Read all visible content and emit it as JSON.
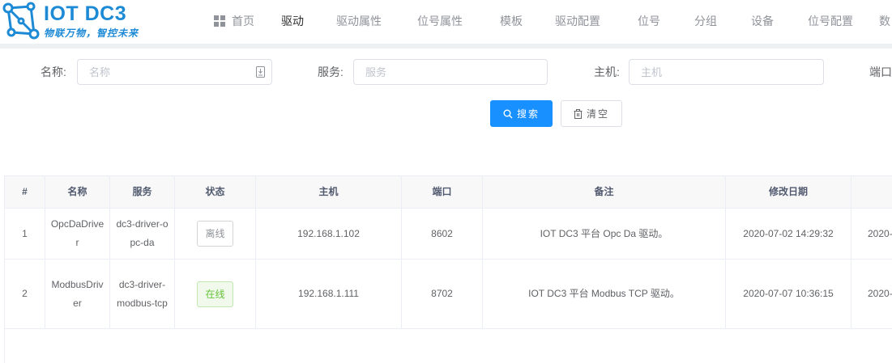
{
  "logo": {
    "title": "IOT DC3",
    "subtitle": "物联万物，智控未来"
  },
  "nav": [
    {
      "label": "首页"
    },
    {
      "label": "驱动"
    },
    {
      "label": "驱动属性"
    },
    {
      "label": "位号属性"
    },
    {
      "label": "模板"
    },
    {
      "label": "驱动配置"
    },
    {
      "label": "位号"
    },
    {
      "label": "分组"
    },
    {
      "label": "设备"
    },
    {
      "label": "位号配置"
    },
    {
      "label": "数"
    }
  ],
  "nav_active": "驱动",
  "search": {
    "name_label": "名称:",
    "name_placeholder": "名称",
    "service_label": "服务:",
    "service_placeholder": "服务",
    "host_label": "主机:",
    "host_placeholder": "主机",
    "port_label": "端口"
  },
  "buttons": {
    "search": "搜索",
    "clear": "清空"
  },
  "table": {
    "columns": [
      "#",
      "名称",
      "服务",
      "状态",
      "主机",
      "端口",
      "备注",
      "修改日期"
    ],
    "rows": [
      {
        "index": "1",
        "name": "OpcDaDriver",
        "service": "dc3-driver-opc-da",
        "status": "离线",
        "host": "192.168.1.102",
        "port": "8602",
        "remark": "IOT DC3 平台 Opc Da 驱动。",
        "modified": "2020-07-02 14:29:32",
        "extra": "2020-"
      },
      {
        "index": "2",
        "name": "ModbusDriver",
        "service": "dc3-driver-modbus-tcp",
        "status": "在线",
        "host": "192.168.1.111",
        "port": "8702",
        "remark": "IOT DC3 平台 Modbus TCP 驱动。",
        "modified": "2020-07-07 10:36:15",
        "extra": "2020-"
      }
    ]
  },
  "colors": {
    "accent": "#1890ff",
    "online": "#67c23a",
    "offline": "#909399"
  }
}
